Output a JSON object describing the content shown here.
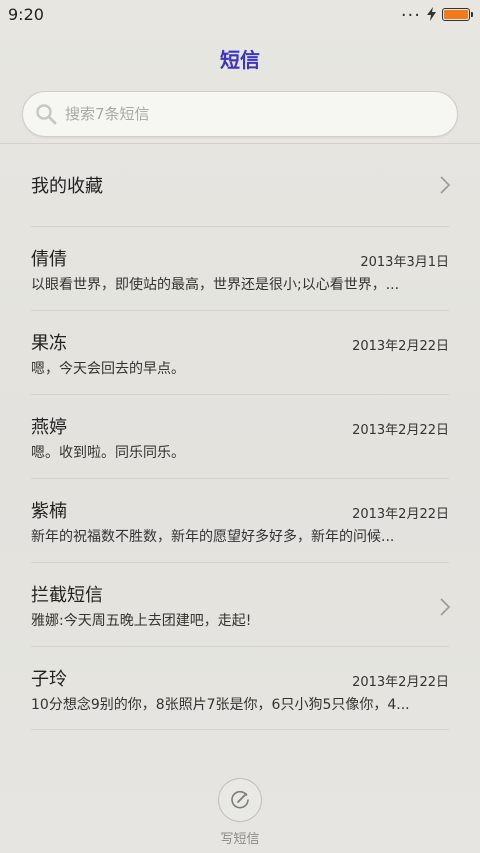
{
  "status_bar": {
    "time": "9:20",
    "dots": "...",
    "charging_icon": "lightning-bolt-icon",
    "battery_color": "#f27a1a"
  },
  "header": {
    "title": "短信",
    "title_color": "#3b33cf"
  },
  "search": {
    "placeholder": "搜索7条短信",
    "value": "",
    "icon": "search-icon"
  },
  "favorites": {
    "label": "我的收藏",
    "icon": "chevron-right-icon"
  },
  "messages": [
    {
      "sender": "倩倩",
      "date": "2013年3月1日",
      "preview": "以眼看世界，即使站的最高，世界还是很小;以心看世界，..."
    },
    {
      "sender": "果冻",
      "date": "2013年2月22日",
      "preview": "嗯，今天会回去的早点。"
    },
    {
      "sender": "燕婷",
      "date": "2013年2月22日",
      "preview": "嗯。收到啦。同乐同乐。"
    },
    {
      "sender": "紫楠",
      "date": "2013年2月22日",
      "preview": "新年的祝福数不胜数，新年的愿望好多好多，新年的问候..."
    },
    {
      "sender": "拦截短信",
      "date": "",
      "preview": "雅娜:今天周五晚上去团建吧，走起!"
    },
    {
      "sender": "子玲",
      "date": "2013年2月22日",
      "preview": "10分想念9别的你，8张照片7张是你，6只小狗5只像你，4..."
    }
  ],
  "compose": {
    "label": "写短信",
    "icon": "compose-pencil-icon"
  }
}
